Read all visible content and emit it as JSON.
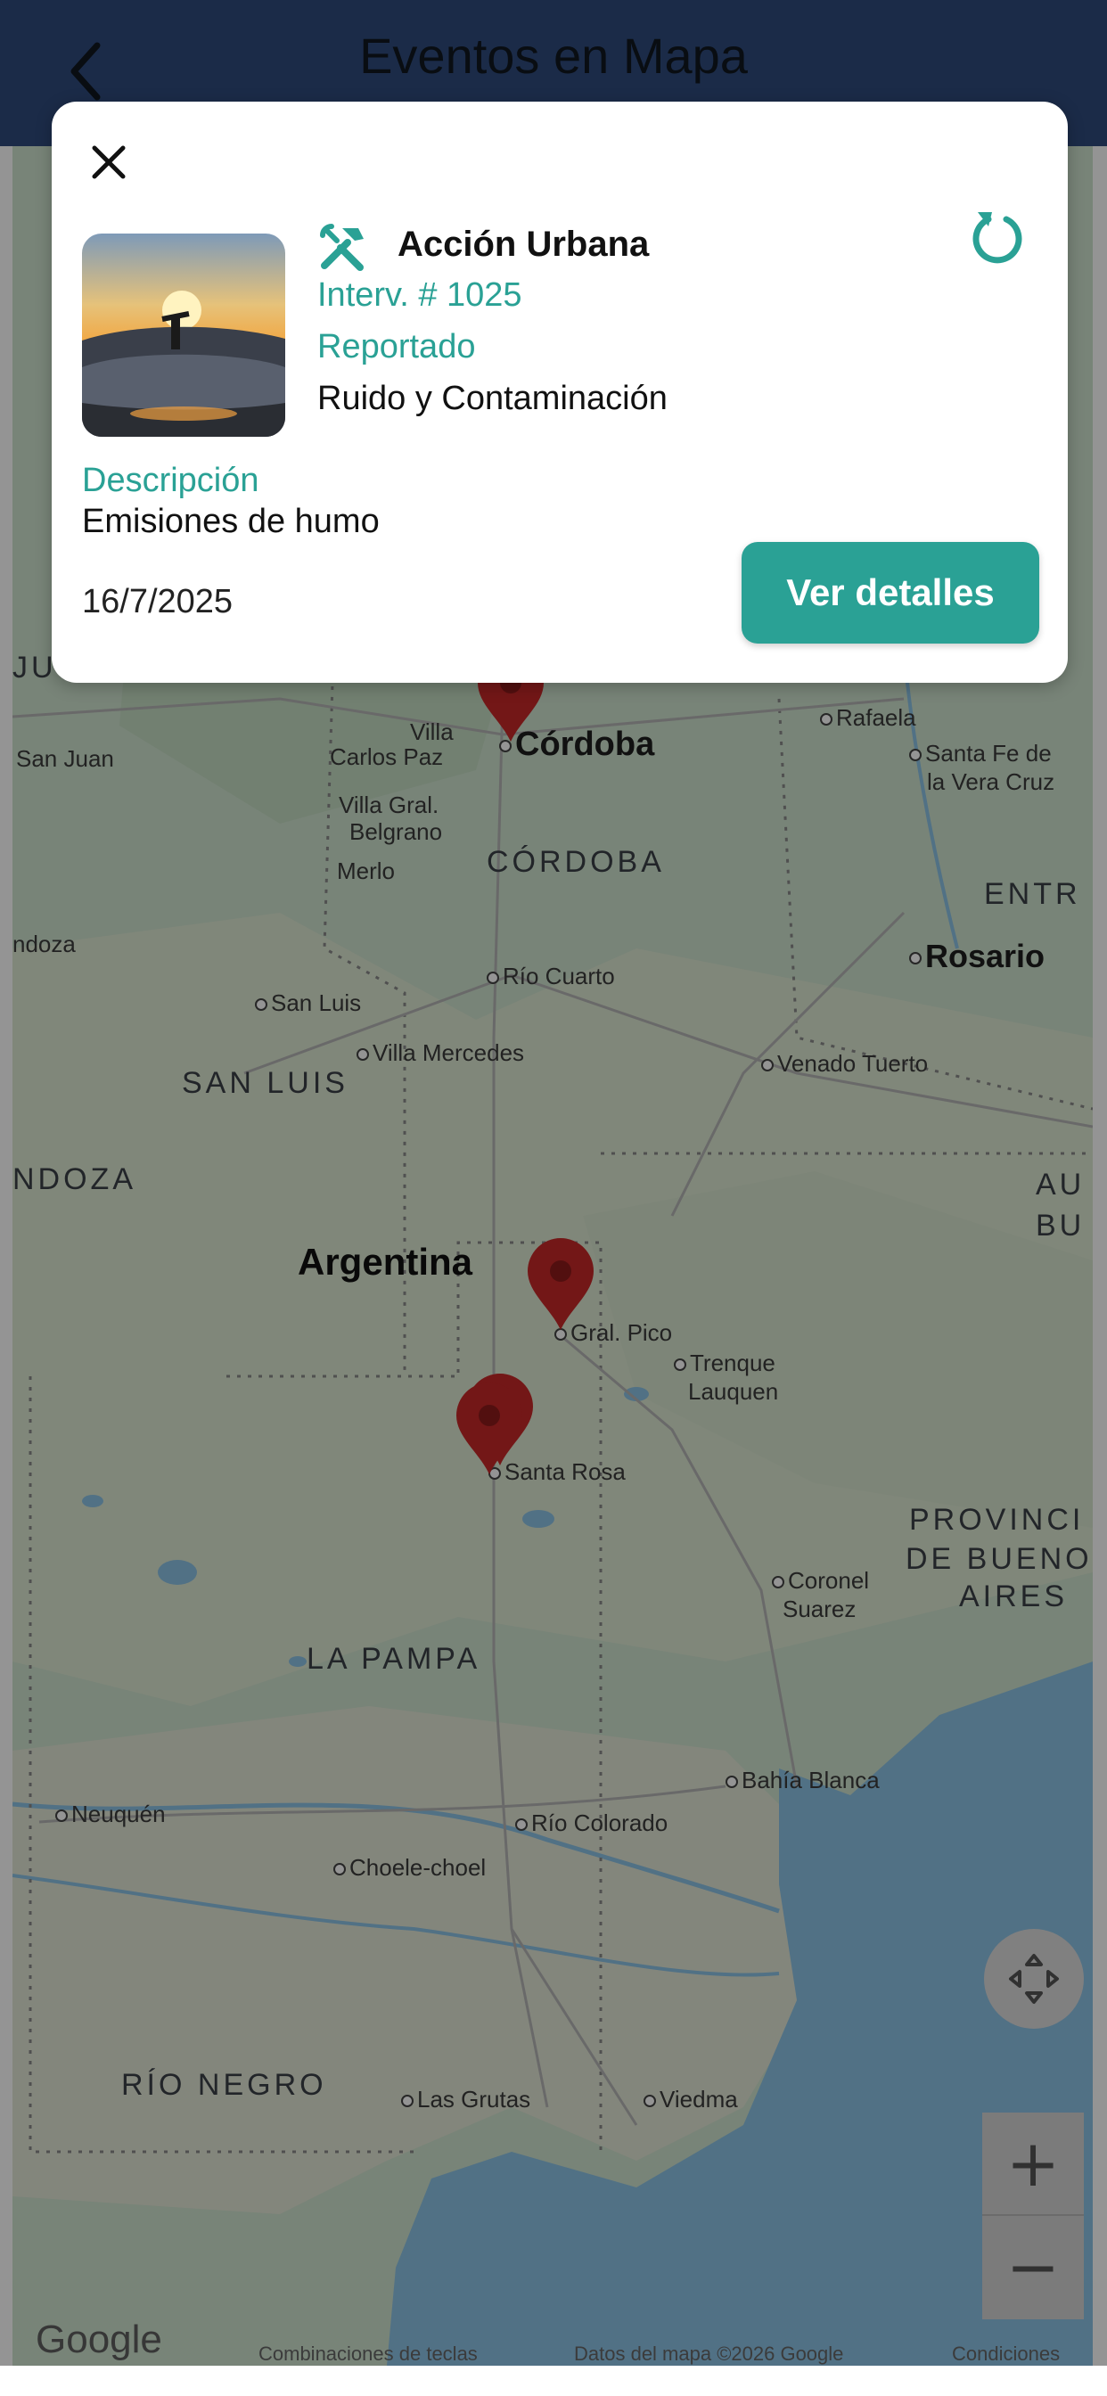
{
  "header": {
    "title": "Eventos en Mapa",
    "back_icon": "chevron-left-icon",
    "background": "#2f4a7d"
  },
  "map": {
    "country": "Argentina",
    "provinces": [
      "CÓRDOBA",
      "SAN LUIS",
      "LA PAMPA",
      "RÍO NEGRO",
      "ENTR",
      "NDOZA",
      "PROVINCI",
      "DE BUENO",
      "AIRES",
      "AU",
      "BU",
      "JU"
    ],
    "cities": {
      "cordoba": "Córdoba",
      "rosario": "Rosario",
      "san_juan": "San Juan",
      "villa_carlos_paz_1": "Villa",
      "villa_carlos_paz_2": "Carlos Paz",
      "villa_gral_belgrano_1": "Villa Gral.",
      "villa_gral_belgrano_2": "Belgrano",
      "merlo": "Merlo",
      "rafaela": "Rafaela",
      "santa_fe_1": "Santa Fe de",
      "santa_fe_2": "la Vera Cruz",
      "mendoza": "ndoza",
      "rio_cuarto": "Río Cuarto",
      "san_luis": "San Luis",
      "villa_mercedes": "Villa Mercedes",
      "venado_tuerto": "Venado Tuerto",
      "gral_pico": "Gral. Pico",
      "trenque_lauquen_1": "Trenque",
      "trenque_lauquen_2": "Lauquen",
      "santa_rosa": "Santa Rosa",
      "coronel_suarez_1": "Coronel",
      "coronel_suarez_2": "Suarez",
      "bahia_blanca": "Bahía Blanca",
      "neuquen": "Neuquén",
      "rio_colorado": "Río Colorado",
      "choele_choel": "Choele-choel",
      "las_grutas": "Las Grutas",
      "viedma": "Viedma"
    },
    "marker_color": "#c62828",
    "google_logo": "Google",
    "attribution": {
      "shortcuts": "Combinaciones de teclas",
      "data": "Datos del mapa ©2026 Google",
      "terms": "Condiciones"
    },
    "zoom_in": "+",
    "zoom_out": "−",
    "locate_icon": "recenter-icon"
  },
  "card": {
    "close_icon": "close-icon",
    "type_icon": "tools-icon",
    "type_title": "Acción Urbana",
    "intervention": "Interv. # 1025",
    "status": "Reportado",
    "category": "Ruido y Contaminación",
    "description_label": "Descripción",
    "description": "Emisiones de humo",
    "date": "16/7/2025",
    "details_button": "Ver detalles",
    "refresh_icon": "refresh-icon",
    "accent": "#2aa195"
  }
}
